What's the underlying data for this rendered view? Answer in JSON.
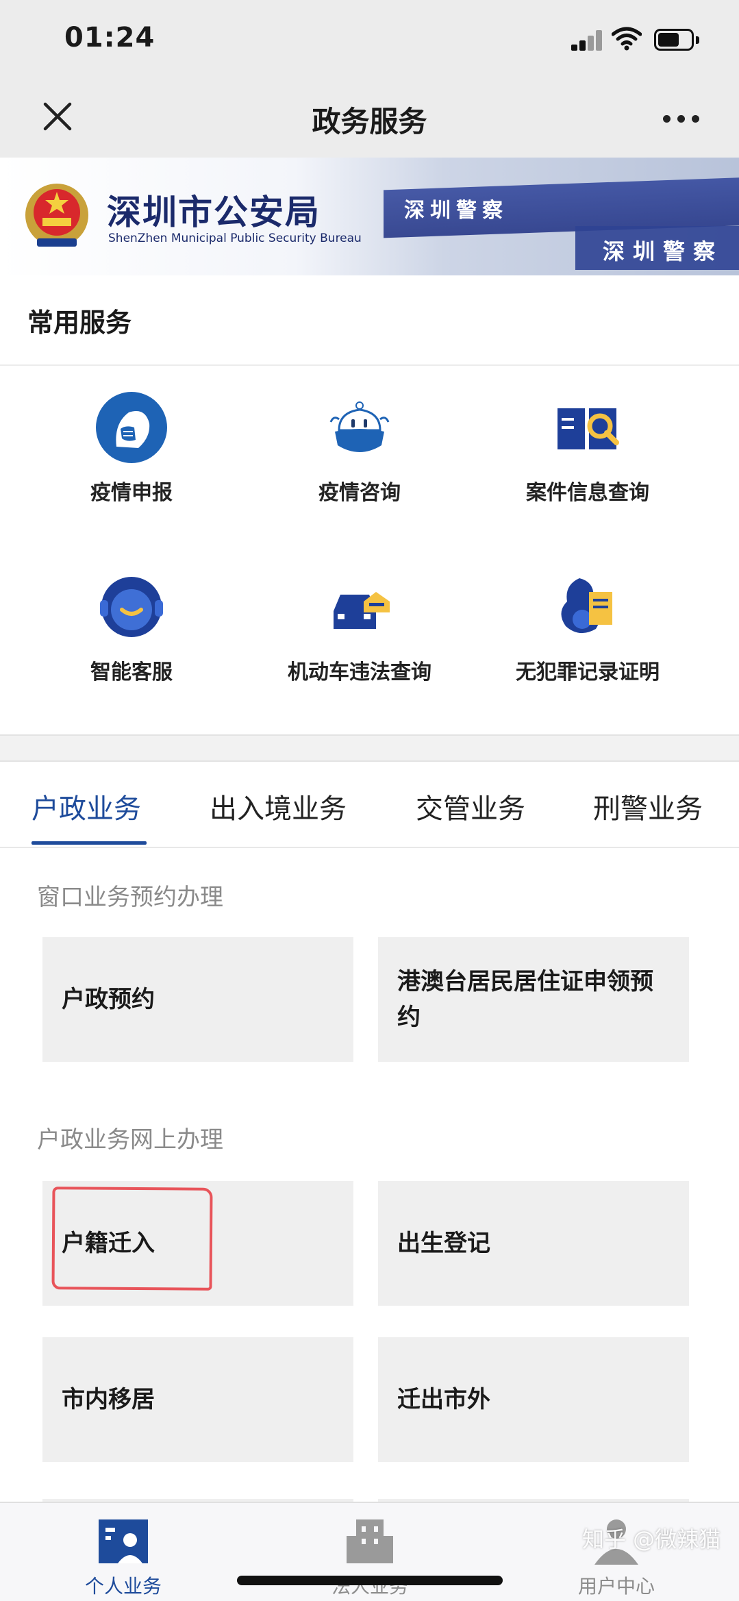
{
  "status_bar": {
    "time": "01:24"
  },
  "nav": {
    "title": "政务服务"
  },
  "banner": {
    "org_name": "深圳市公安局",
    "org_name_en": "ShenZhen Municipal Public Security Bureau",
    "sign_text_1": "深圳警察",
    "sign_text_2": "深圳警察"
  },
  "common_services": {
    "title": "常用服务",
    "items": [
      {
        "label": "疫情申报",
        "icon": "mask-person-icon"
      },
      {
        "label": "疫情咨询",
        "icon": "mascot-icon"
      },
      {
        "label": "案件信息查询",
        "icon": "book-search-icon"
      },
      {
        "label": "智能客服",
        "icon": "headset-robot-icon"
      },
      {
        "label": "机动车违法查询",
        "icon": "car-violation-icon"
      },
      {
        "label": "无犯罪记录证明",
        "icon": "certificate-icon"
      }
    ]
  },
  "tabs": [
    {
      "label": "户政业务",
      "active": true
    },
    {
      "label": "出入境业务",
      "active": false
    },
    {
      "label": "交管业务",
      "active": false
    },
    {
      "label": "刑警业务",
      "active": false
    }
  ],
  "groups": {
    "appointment": {
      "label": "窗口业务预约办理",
      "cards": [
        "户政预约",
        "港澳台居民居住证申领预约"
      ]
    },
    "online": {
      "label": "户政业务网上办理",
      "cards": [
        "户籍迁入",
        "出生登记",
        "市内移居",
        "迁出市外"
      ]
    }
  },
  "bottom_nav": [
    {
      "label": "个人业务",
      "icon": "personal-card-icon",
      "active": true
    },
    {
      "label": "法人业务",
      "icon": "building-icon",
      "active": false
    },
    {
      "label": "用户中心",
      "icon": "user-icon",
      "active": false
    }
  ],
  "watermark": "知乎 @微辣猫",
  "colors": {
    "brand_blue": "#1e4b9b",
    "card_bg": "#efefef",
    "annotation_red": "#e8545a"
  }
}
